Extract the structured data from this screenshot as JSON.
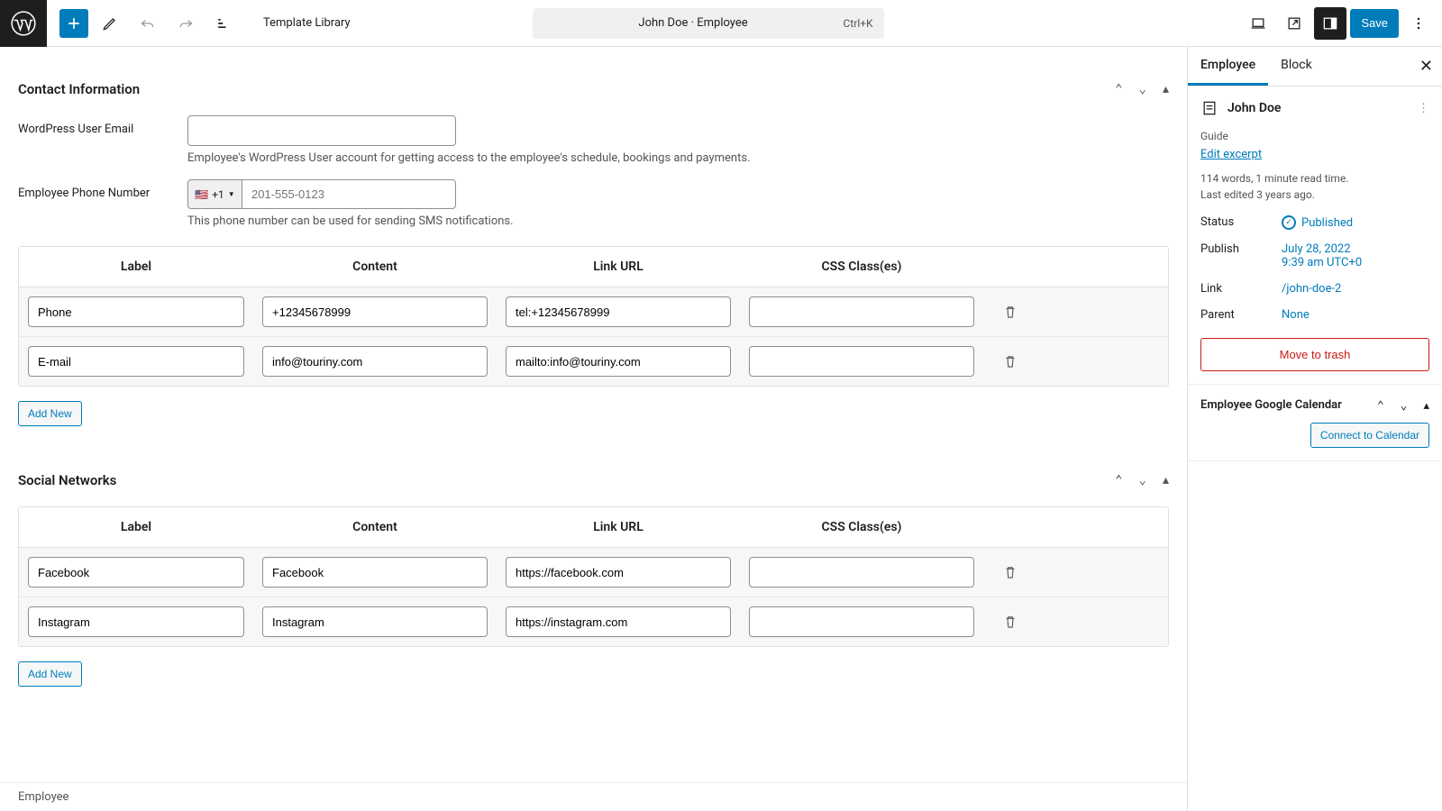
{
  "toolbar": {
    "template_library": "Template Library",
    "title": "John Doe · Employee",
    "shortcut": "Ctrl+K",
    "save": "Save"
  },
  "contact": {
    "title": "Contact Information",
    "wp_email_label": "WordPress User Email",
    "wp_email_value": "",
    "wp_email_help": "Employee's WordPress User account for getting access to the employee's schedule, bookings and payments.",
    "phone_label": "Employee Phone Number",
    "phone_prefix": "+1",
    "phone_placeholder": "201-555-0123",
    "phone_value": "",
    "phone_help": "This phone number can be used for sending SMS notifications.",
    "columns": {
      "label": "Label",
      "content": "Content",
      "url": "Link URL",
      "css": "CSS Class(es)"
    },
    "rows": [
      {
        "label": "Phone",
        "content": "+12345678999",
        "url": "tel:+12345678999",
        "css": ""
      },
      {
        "label": "E-mail",
        "content": "info@touriny.com",
        "url": "mailto:info@touriny.com",
        "css": ""
      }
    ],
    "add_new": "Add New"
  },
  "social": {
    "title": "Social Networks",
    "columns": {
      "label": "Label",
      "content": "Content",
      "url": "Link URL",
      "css": "CSS Class(es)"
    },
    "rows": [
      {
        "label": "Facebook",
        "content": "Facebook",
        "url": "https://facebook.com",
        "css": ""
      },
      {
        "label": "Instagram",
        "content": "Instagram",
        "url": "https://instagram.com",
        "css": ""
      }
    ],
    "add_new": "Add New"
  },
  "breadcrumb": "Employee",
  "sidebar": {
    "tabs": {
      "employee": "Employee",
      "block": "Block"
    },
    "doc_title": "John Doe",
    "guide": "Guide",
    "edit_excerpt": "Edit excerpt",
    "meta1": "114 words, 1 minute read time.",
    "meta2": "Last edited 3 years ago.",
    "status_k": "Status",
    "status_v": "Published",
    "publish_k": "Publish",
    "publish_v1": "July 28, 2022",
    "publish_v2": "9:39 am UTC+0",
    "link_k": "Link",
    "link_v": "/john-doe-2",
    "parent_k": "Parent",
    "parent_v": "None",
    "trash": "Move to trash",
    "cal_label": "Employee Google Calendar",
    "connect": "Connect to Calendar"
  }
}
